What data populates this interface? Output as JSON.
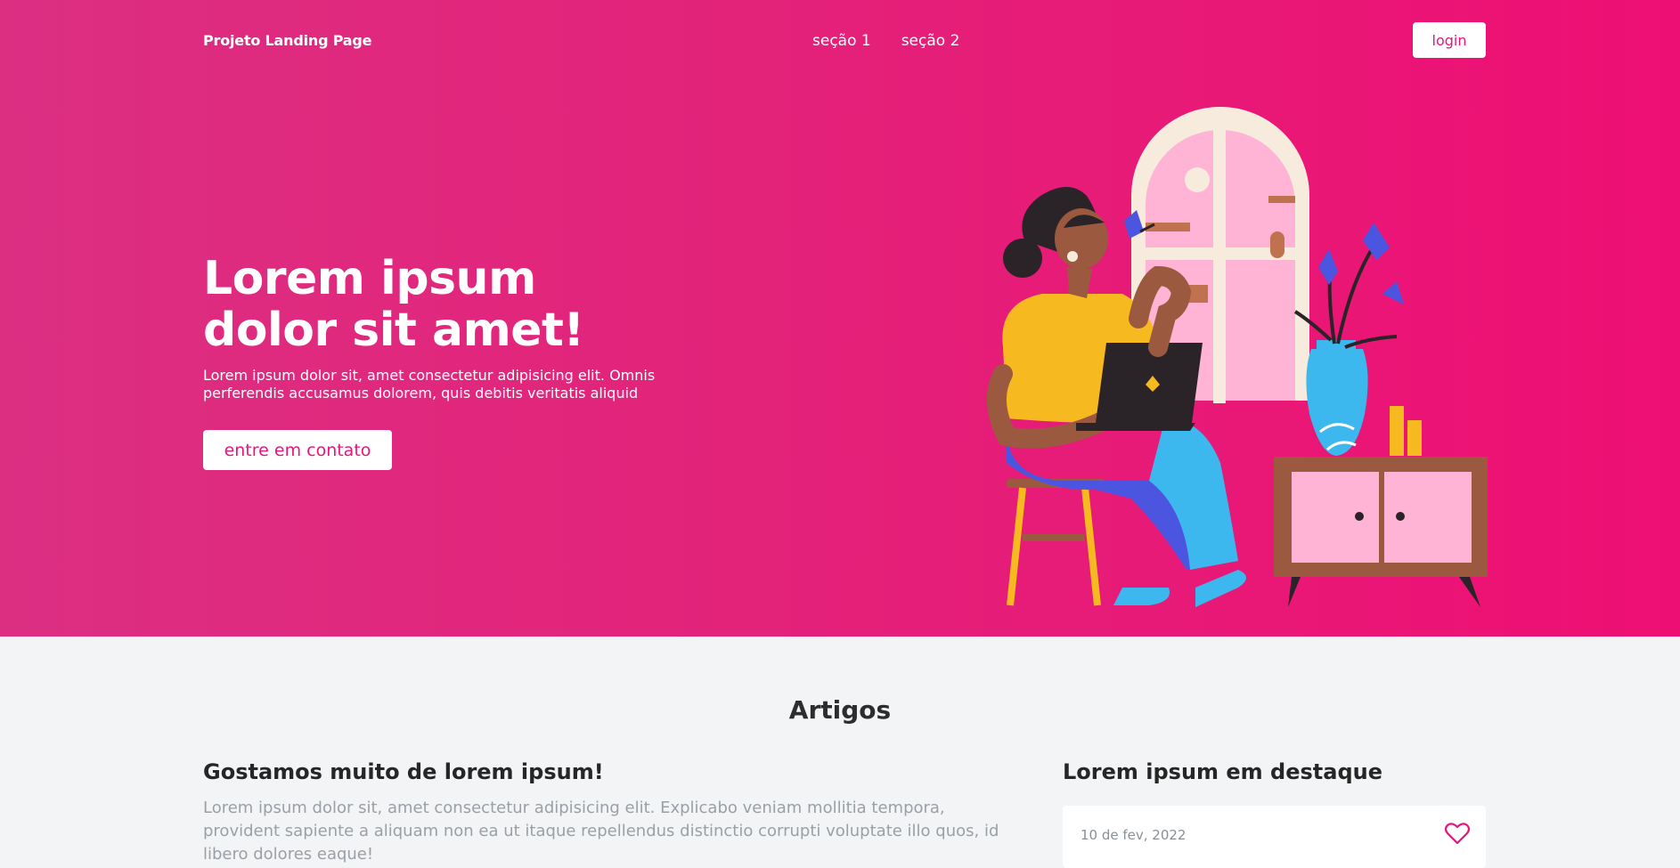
{
  "nav": {
    "brand": "Projeto Landing Page",
    "links": [
      "seção 1",
      "seção 2"
    ],
    "login_label": "login"
  },
  "hero": {
    "title": "Lorem ipsum\ndolor sit amet!",
    "description": "Lorem ipsum dolor sit, amet consectetur adipisicing elit. Omnis perferendis accusamus dolorem, quis debitis veritatis aliquid",
    "cta_label": "entre em contato"
  },
  "articles": {
    "section_title": "Artigos",
    "post": {
      "title": "Gostamos muito de lorem ipsum!",
      "text": "Lorem ipsum dolor sit, amet consectetur adipisicing elit. Explicabo veniam mollitia tempora, provident sapiente a aliquam non ea ut itaque repellendus distinctio corrupti voluptate illo quos, id libero dolores eaque!"
    },
    "featured": {
      "title": "Lorem ipsum em destaque",
      "card_date": "10 de fev, 2022"
    }
  },
  "colors": {
    "brand_pink": "#e8157a",
    "gradient_start": "#dc2f82",
    "gradient_end": "#ee0f74",
    "background": "#f3f4f6"
  },
  "icons": {
    "heart": "heart-icon",
    "illustration": "woman-with-laptop-illustration"
  }
}
